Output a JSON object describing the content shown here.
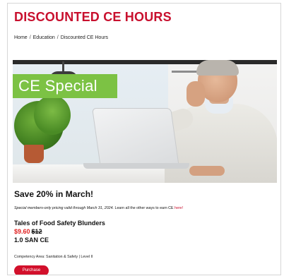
{
  "page": {
    "title": "DISCOUNTED CE HOURS"
  },
  "breadcrumb": {
    "items": [
      "Home",
      "Education",
      "Discounted CE Hours"
    ],
    "separator": "/"
  },
  "hero": {
    "banner_text": "CE Special"
  },
  "promo": {
    "heading": "Save 20% in March!",
    "note_italic": "Special members-only pricing valid through March 31, 2024.",
    "note_text": " Learn all the other ways to earn CE ",
    "note_link": "here!"
  },
  "course": {
    "name": "Tales of Food Safety Blunders",
    "sale_price": "$9.60",
    "original_price": "$12",
    "credits": "1.0 SAN CE",
    "competency": "Competency Area: Sanitation & Safety | Level II",
    "button_label": "Purchase"
  },
  "colors": {
    "brand_red": "#c8102e",
    "sale_red": "#e02020",
    "banner_green": "#7cc244"
  }
}
